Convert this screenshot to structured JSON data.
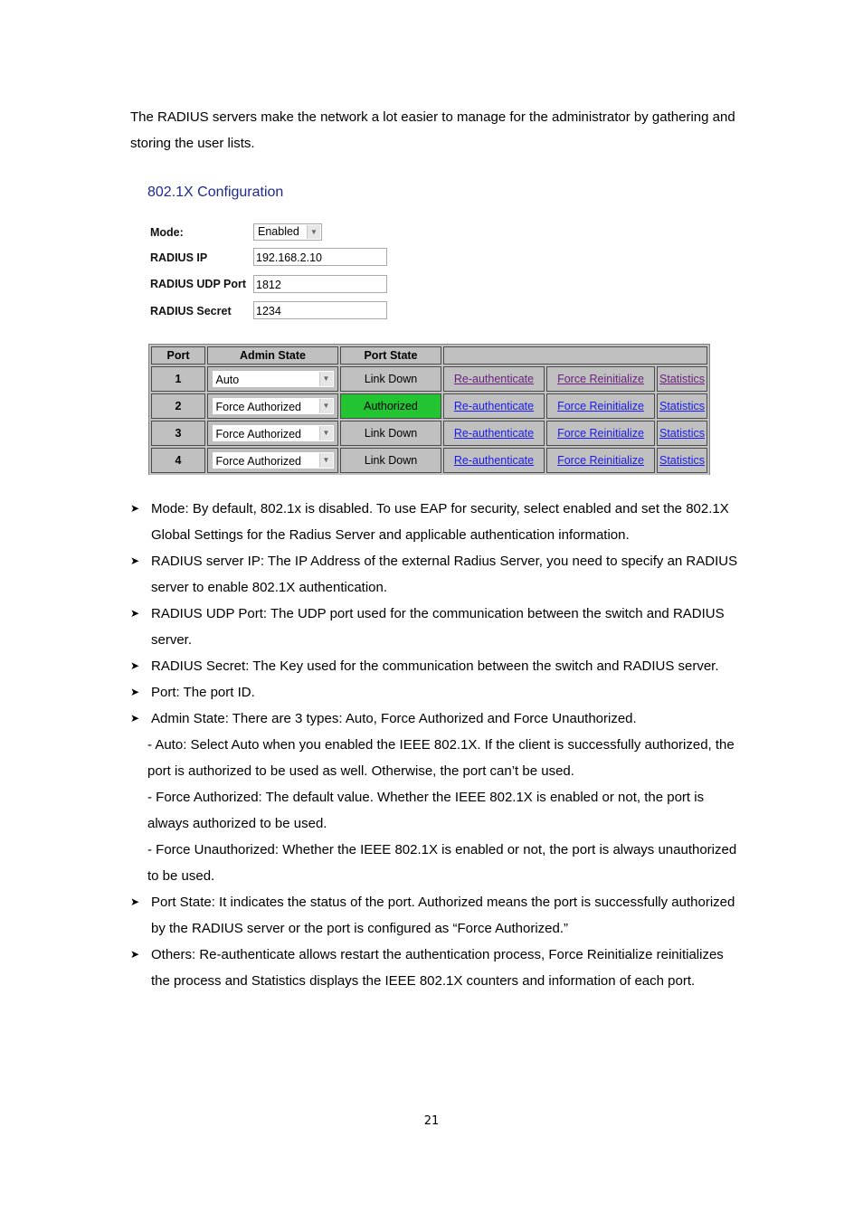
{
  "intro": "The RADIUS servers make the network a lot easier to manage for the administrator by gathering and storing the user lists.",
  "config": {
    "title": "802.1X Configuration",
    "mode_label": "Mode:",
    "mode_value": "Enabled",
    "radius_ip_label": "RADIUS IP",
    "radius_ip_value": "192.168.2.10",
    "udp_port_label": "RADIUS UDP Port",
    "udp_port_value": "1812",
    "secret_label": "RADIUS Secret",
    "secret_value": "1234"
  },
  "table": {
    "headers": [
      "Port",
      "Admin State",
      "Port State",
      ""
    ],
    "rows": [
      {
        "port": "1",
        "admin_state": "Auto",
        "port_state": "Link Down",
        "authorized": false,
        "reauth": "Re-authenticate",
        "reinit": "Force Reinitialize",
        "stats": "Statistics",
        "visited": true
      },
      {
        "port": "2",
        "admin_state": "Force Authorized",
        "port_state": "Authorized",
        "authorized": true,
        "reauth": "Re-authenticate",
        "reinit": "Force Reinitialize",
        "stats": "Statistics",
        "visited": false
      },
      {
        "port": "3",
        "admin_state": "Force Authorized",
        "port_state": "Link Down",
        "authorized": false,
        "reauth": "Re-authenticate",
        "reinit": "Force Reinitialize",
        "stats": "Statistics",
        "visited": false
      },
      {
        "port": "4",
        "admin_state": "Force Authorized",
        "port_state": "Link Down",
        "authorized": false,
        "reauth": "Re-authenticate",
        "reinit": "Force Reinitialize",
        "stats": "Statistics",
        "visited": false
      }
    ],
    "authorized_color": "#22c432",
    "link_color": "#1a1aee",
    "visited_link_color": "#6a1e7e"
  },
  "bullets": {
    "mode": "Mode: By default, 802.1x is disabled. To use EAP for security, select enabled and set the 802.1X Global Settings for the Radius Server and applicable authentication information.",
    "radius_ip": "RADIUS server IP: The IP Address of the external Radius Server, you need to specify an RADIUS server to enable 802.1X authentication.",
    "udp_port": "RADIUS UDP Port: The UDP port used for the communication between the switch and RADIUS server.",
    "secret": "RADIUS Secret: The Key used for the communication between the switch and RADIUS server.",
    "port": "Port: The port ID.",
    "admin_state": "Admin State: There are 3 types: Auto, Force Authorized and Force Unauthorized.",
    "admin_auto": "- Auto: Select Auto when you enabled the IEEE 802.1X. If the client is successfully authorized, the port is authorized to be used as well. Otherwise, the port can’t be used.",
    "admin_force_auth": "- Force Authorized: The default value. Whether the IEEE 802.1X is enabled or not, the port is always authorized to be used.",
    "admin_force_unauth": "- Force Unauthorized: Whether the IEEE 802.1X is enabled or not, the port is always unauthorized to be used.",
    "port_state": "Port State: It indicates the status of the port. Authorized means the port is successfully authorized by the RADIUS server or the port is configured as “Force Authorized.”",
    "others": "Others: Re-authenticate allows restart the authentication process, Force Reinitialize reinitializes the process and Statistics displays the IEEE 802.1X counters and information of each port."
  },
  "page_number": "21"
}
